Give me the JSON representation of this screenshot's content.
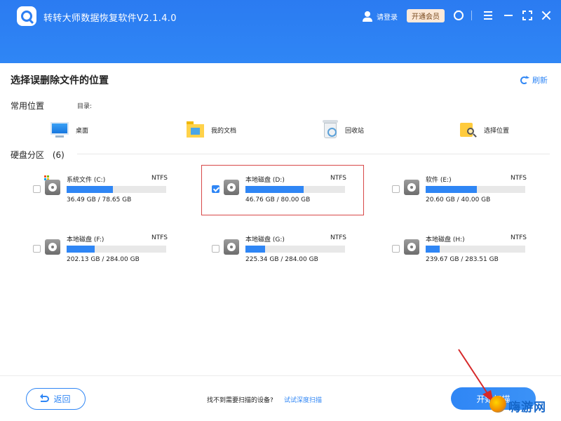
{
  "header": {
    "title": "转转大师数据恢复软件V2.1.4.0",
    "login": "请登录",
    "vip": "开通会员",
    "icons": [
      "app-logo-icon",
      "user-icon",
      "support-icon",
      "menu-icon",
      "minimize-icon",
      "maximize-icon",
      "close-icon"
    ]
  },
  "main": {
    "title": "选择误删除文件的位置",
    "refresh": "刷新"
  },
  "common": {
    "label": "常用位置",
    "dir_label": "目录:",
    "items": [
      {
        "label": "桌面",
        "icon": "desktop-icon"
      },
      {
        "label": "我的文档",
        "icon": "documents-folder-icon"
      },
      {
        "label": "回收站",
        "icon": "recycle-bin-icon"
      },
      {
        "label": "选择位置",
        "icon": "folder-search-icon"
      }
    ]
  },
  "disks": {
    "label": "硬盘分区",
    "count": "(6)",
    "items": [
      {
        "name": "系统文件 (C:)",
        "fs": "NTFS",
        "size": "36.49 GB / 78.65 GB",
        "used_fraction": 0.464,
        "checked": false,
        "system": true
      },
      {
        "name": "本地磁盘 (D:)",
        "fs": "NTFS",
        "size": "46.76 GB / 80.00 GB",
        "used_fraction": 0.585,
        "checked": true,
        "system": false
      },
      {
        "name": "软件 (E:)",
        "fs": "NTFS",
        "size": "20.60 GB / 40.00 GB",
        "used_fraction": 0.515,
        "checked": false,
        "system": false
      },
      {
        "name": "本地磁盘 (F:)",
        "fs": "NTFS",
        "size": "202.13 GB / 284.00 GB",
        "used_fraction": 0.28,
        "checked": false,
        "system": false
      },
      {
        "name": "本地磁盘 (G:)",
        "fs": "NTFS",
        "size": "225.34 GB / 284.00 GB",
        "used_fraction": 0.2,
        "checked": false,
        "system": false
      },
      {
        "name": "本地磁盘 (H:)",
        "fs": "NTFS",
        "size": "239.67 GB / 283.51 GB",
        "used_fraction": 0.14,
        "checked": false,
        "system": false
      }
    ]
  },
  "footer": {
    "back": "返回",
    "hint": "找不到需要扫描的设备?",
    "deep_scan": "试试深度扫描",
    "start": "开始扫描"
  },
  "watermark": {
    "text": "嗨游网"
  },
  "colors": {
    "accent": "#2f86f5",
    "header_bg": "#2b7bf1",
    "selection_outline": "#d84848",
    "vip_bg": "#fce9d8",
    "annotation_arrow": "#d6292a"
  }
}
